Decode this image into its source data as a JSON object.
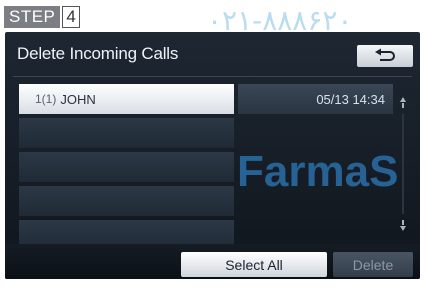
{
  "step": {
    "word": "STEP",
    "number": "4"
  },
  "watermark_top": "۰۲۱-۸۸۸۶۲۰",
  "screen": {
    "title": "Delete Incoming Calls",
    "back_icon": "return-arrow-icon",
    "rows": [
      {
        "count": "1(1)",
        "name": "JOHN",
        "date": "05/13 14:34"
      },
      {
        "count": "",
        "name": "",
        "date": ""
      },
      {
        "count": "",
        "name": "",
        "date": ""
      },
      {
        "count": "",
        "name": "",
        "date": ""
      },
      {
        "count": "",
        "name": "",
        "date": ""
      }
    ],
    "select_all_label": "Select All",
    "delete_label": "Delete"
  },
  "watermark_farma": "FarmaS",
  "colors": {
    "accent_button": "#ffffff",
    "screen_bg": "#1a222c"
  }
}
